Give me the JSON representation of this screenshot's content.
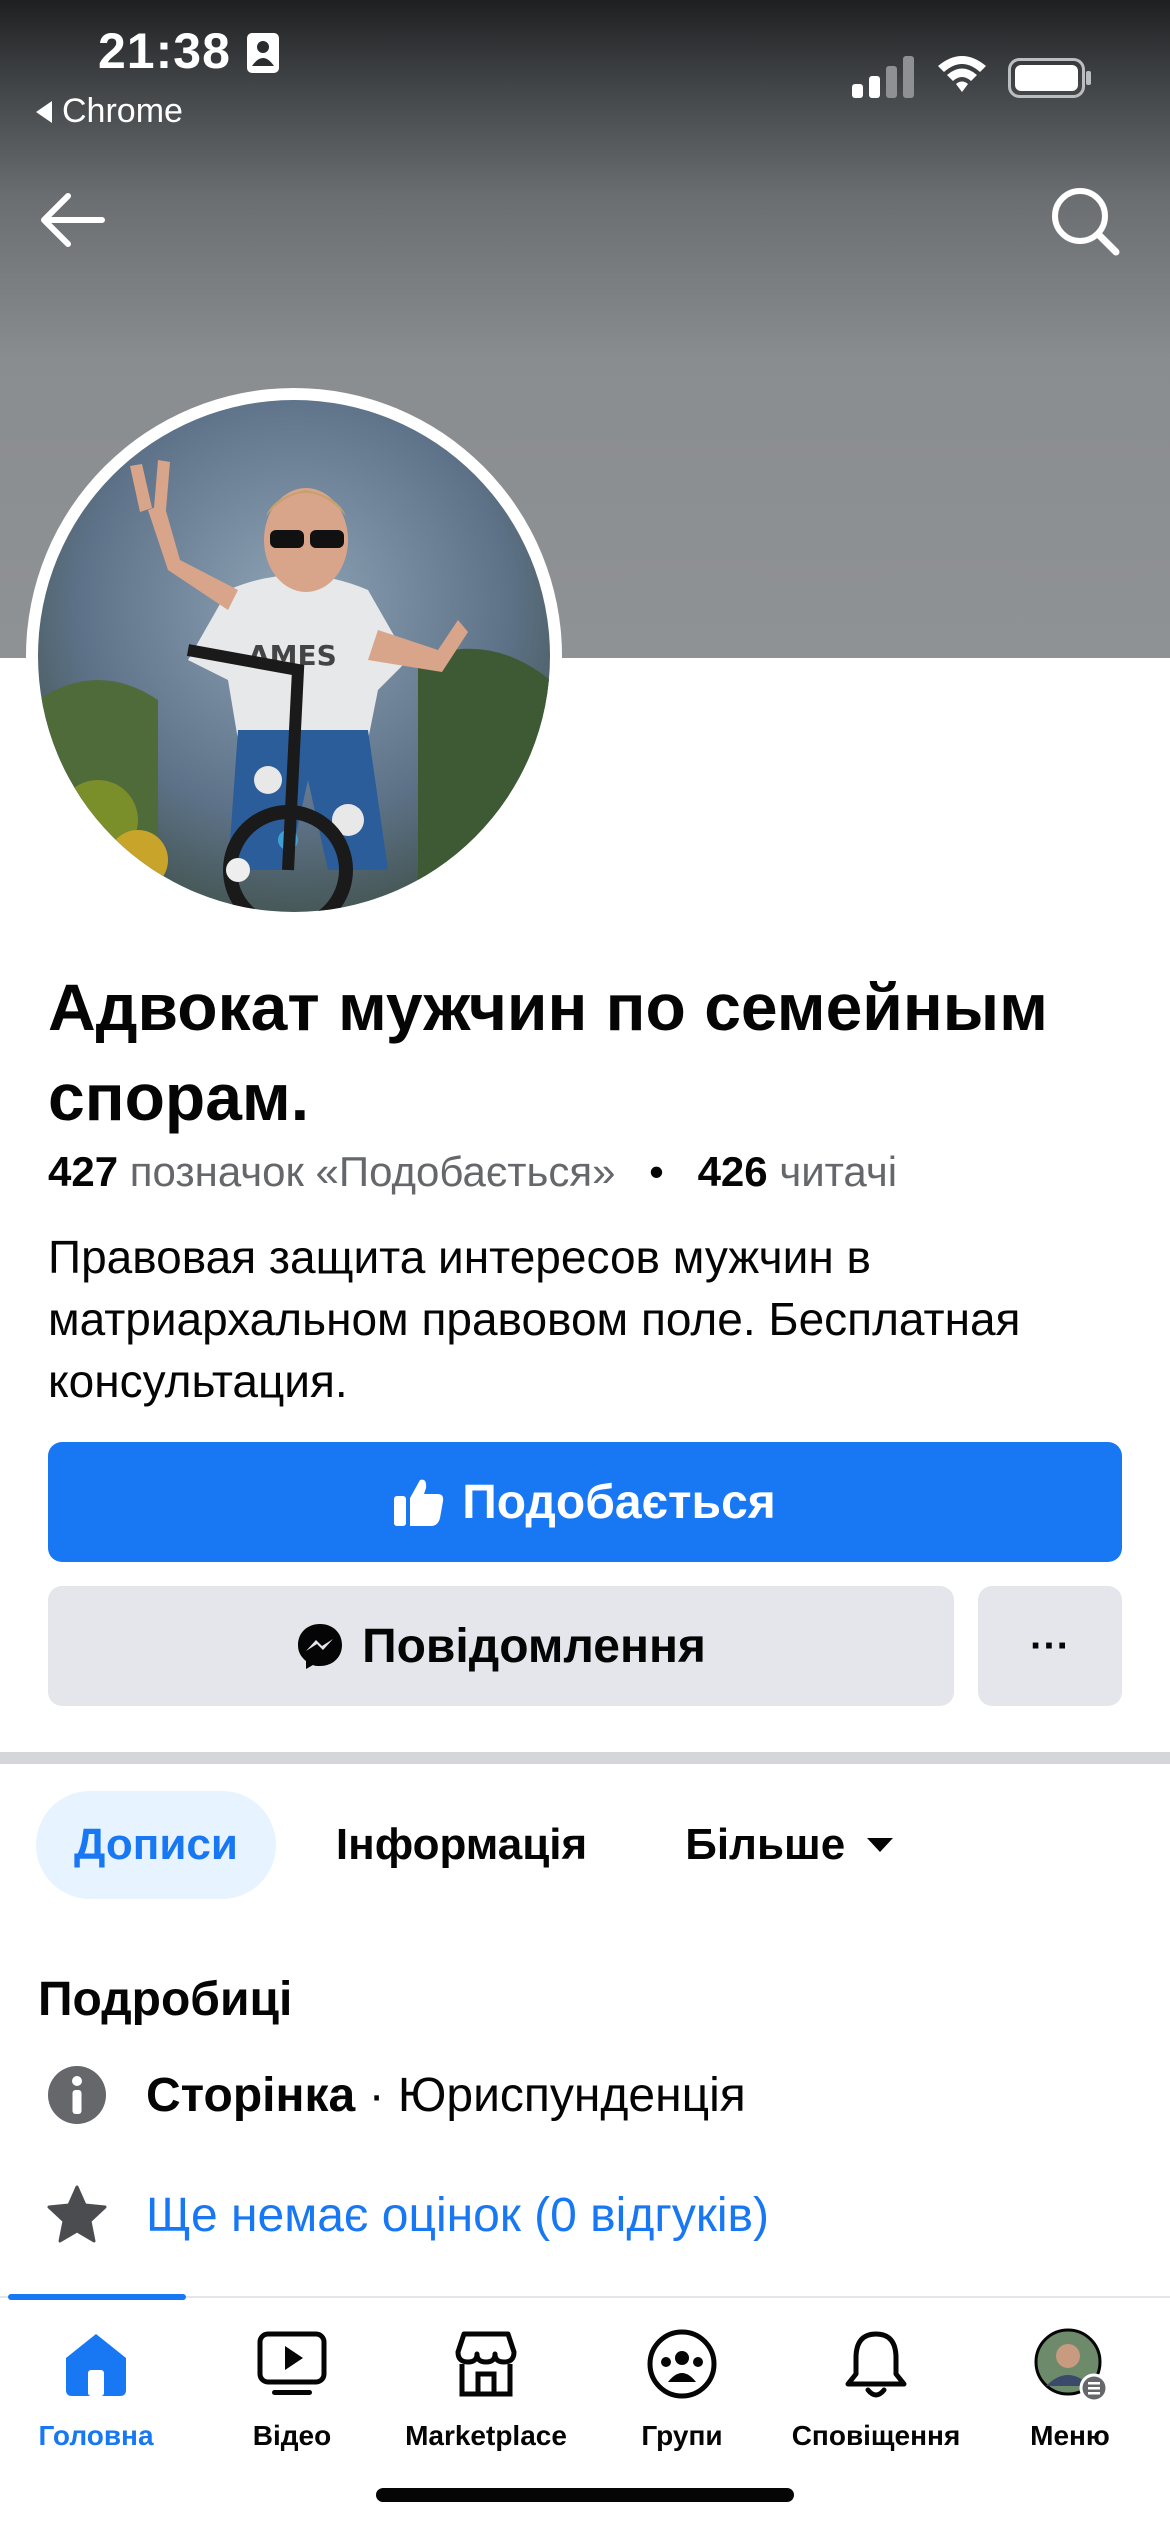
{
  "status_bar": {
    "time": "21:38",
    "back_app": "Chrome"
  },
  "profile": {
    "title": "Адвокат мужчин по семейным спорам.",
    "likes_count": "427",
    "likes_label": "позначок «Подобається»",
    "separator": "•",
    "followers_count": "426",
    "followers_label": "читачі",
    "description": "Правовая защита интересов мужчин в матриархальном правовом поле. Бесплатная консультация."
  },
  "actions": {
    "like_label": "Подобається",
    "message_label": "Повідомлення",
    "more_label": "···"
  },
  "tabs": {
    "posts": "Дописи",
    "info": "Інформація",
    "more": "Більше"
  },
  "details": {
    "title": "Подробиці",
    "page_type_label": "Сторінка",
    "page_type_sep": " · ",
    "page_category": "Юриспунденція",
    "ratings": "Ще немає оцінок (0 відгуків)"
  },
  "bottom_nav": {
    "home": "Головна",
    "video": "Відео",
    "marketplace": "Marketplace",
    "groups": "Групи",
    "notifications": "Сповіщення",
    "menu": "Меню"
  },
  "colors": {
    "accent": "#1877f2",
    "button_gray": "#e4e6eb",
    "text_secondary": "#65676b",
    "tab_active_bg": "#e7f3ff"
  },
  "icons": [
    "back-arrow-icon",
    "search-icon",
    "thumbs-up-icon",
    "messenger-icon",
    "info-icon",
    "star-icon",
    "home-icon",
    "video-icon",
    "marketplace-icon",
    "groups-icon",
    "bell-icon",
    "menu-avatar"
  ]
}
